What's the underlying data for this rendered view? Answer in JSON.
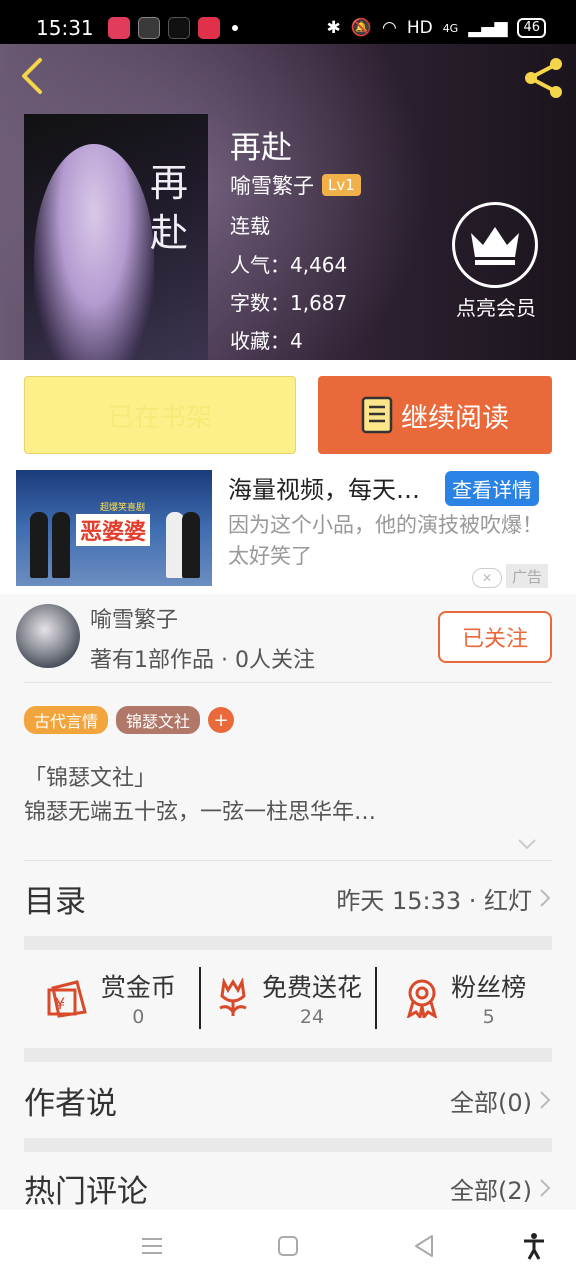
{
  "status_bar": {
    "time": "15:31",
    "network": "HD",
    "signal": "4G",
    "battery": "46"
  },
  "book": {
    "title": "再赴",
    "cover_title": "再赴",
    "author": "喻雪繁子",
    "level": "Lv1",
    "status": "连载",
    "popularity": "人气：4,464",
    "words": "字数：1,687",
    "favorites": "收藏：4"
  },
  "member": {
    "label": "点亮会员"
  },
  "actions": {
    "shelf_label": "已在书架",
    "read_label": "继续阅读"
  },
  "ad": {
    "image_title": "恶婆婆",
    "image_sub": "超爆笑喜剧",
    "headline": "海量视频，每天都有新内容",
    "detail_label": "查看详情",
    "description": "因为这个小品，他的演技被吹爆！太好笑了",
    "tag": "广告"
  },
  "author_card": {
    "name": "喻雪繁子",
    "stats": "著有1部作品 · 0人关注",
    "follow_label": "已关注"
  },
  "tags": [
    {
      "label": "古代言情",
      "color": "#f2a53c"
    },
    {
      "label": "锦瑟文社",
      "color": "#b07868"
    }
  ],
  "description": {
    "line1": "「锦瑟文社」",
    "line2": "锦瑟无端五十弦，一弦一柱思华年…"
  },
  "toc": {
    "title": "目录",
    "latest": "昨天 15:33 · 红灯"
  },
  "stats": [
    {
      "label": "赏金币",
      "value": "0",
      "icon": "coin-envelope-icon"
    },
    {
      "label": "免费送花",
      "value": "24",
      "icon": "flower-icon"
    },
    {
      "label": "粉丝榜",
      "value": "5",
      "icon": "medal-icon"
    }
  ],
  "author_says": {
    "title": "作者说",
    "link": "全部(0)"
  },
  "hot_comments": {
    "title": "热门评论",
    "link": "全部(2)"
  },
  "colors": {
    "accent": "#e9693a",
    "tag_orange": "#f2a53c",
    "shelf_yellow": "#fdf08a",
    "ad_blue": "#2a82e4"
  }
}
